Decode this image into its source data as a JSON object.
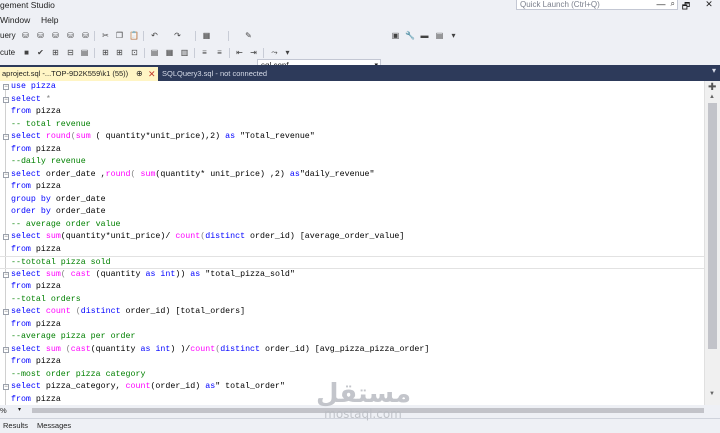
{
  "window": {
    "title": "gement Studio",
    "quick_launch_placeholder": "Quick Launch (Ctrl+Q)",
    "controls": [
      "—",
      "🗗",
      "✕"
    ]
  },
  "menu": [
    "Window",
    "Help"
  ],
  "toolbar1": {
    "left_label": "uery",
    "database": "sql conf"
  },
  "toolbar2": {
    "left_label": "cute"
  },
  "tabs": [
    {
      "label": "aproject.sql -...TOP-9D2K559\\k1 (55))",
      "pin": "⊕",
      "close": "✕",
      "active": true
    },
    {
      "label": "SQLQuery3.sql - not connected",
      "active": false
    }
  ],
  "editor": {
    "lines": [
      {
        "fold": "−",
        "segments": [
          {
            "t": "use pizza",
            "c": "kw"
          }
        ]
      },
      {
        "fold": "−",
        "segments": [
          {
            "t": "select",
            "c": "kw"
          },
          {
            "t": " *",
            "c": "gr"
          }
        ]
      },
      {
        "fold": "",
        "segments": [
          {
            "t": "from",
            "c": "kw"
          },
          {
            "t": " pizza",
            "c": "tx"
          }
        ]
      },
      {
        "fold": "",
        "segments": [
          {
            "t": "-- total revenue",
            "c": "cm"
          }
        ]
      },
      {
        "fold": "−",
        "segments": [
          {
            "t": "select",
            "c": "kw"
          },
          {
            "t": " ",
            "c": "tx"
          },
          {
            "t": "round",
            "c": "fn"
          },
          {
            "t": "(",
            "c": "gr"
          },
          {
            "t": "sum",
            "c": "fn"
          },
          {
            "t": " ( quantity*unit_price),2) ",
            "c": "tx"
          },
          {
            "t": "as",
            "c": "kw"
          },
          {
            "t": " \"Total_revenue\"",
            "c": "tx"
          }
        ]
      },
      {
        "fold": "",
        "segments": [
          {
            "t": "from",
            "c": "kw"
          },
          {
            "t": " pizza",
            "c": "tx"
          }
        ]
      },
      {
        "fold": "",
        "segments": [
          {
            "t": "--daily revenue",
            "c": "cm"
          }
        ]
      },
      {
        "fold": "−",
        "segments": [
          {
            "t": "select",
            "c": "kw"
          },
          {
            "t": " order_date ,",
            "c": "tx"
          },
          {
            "t": "round",
            "c": "fn"
          },
          {
            "t": "( ",
            "c": "gr"
          },
          {
            "t": "sum",
            "c": "fn"
          },
          {
            "t": "(quantity* unit_price) ,2) ",
            "c": "tx"
          },
          {
            "t": "as",
            "c": "kw"
          },
          {
            "t": "\"daily_revenue\"",
            "c": "tx"
          }
        ]
      },
      {
        "fold": "",
        "segments": [
          {
            "t": "from",
            "c": "kw"
          },
          {
            "t": " pizza",
            "c": "tx"
          }
        ]
      },
      {
        "fold": "",
        "segments": [
          {
            "t": "group by",
            "c": "kw"
          },
          {
            "t": " order_date",
            "c": "tx"
          }
        ]
      },
      {
        "fold": "",
        "segments": [
          {
            "t": "order by",
            "c": "kw"
          },
          {
            "t": " order_date",
            "c": "tx"
          }
        ]
      },
      {
        "fold": "",
        "segments": [
          {
            "t": "-- average order value",
            "c": "cm"
          }
        ]
      },
      {
        "fold": "−",
        "segments": [
          {
            "t": "select",
            "c": "kw"
          },
          {
            "t": " ",
            "c": "tx"
          },
          {
            "t": "sum",
            "c": "fn"
          },
          {
            "t": "(quantity*unit_price)/ ",
            "c": "tx"
          },
          {
            "t": "count",
            "c": "fn"
          },
          {
            "t": "(",
            "c": "gr"
          },
          {
            "t": "distinct",
            "c": "kw"
          },
          {
            "t": " order_id) [average_order_value]",
            "c": "tx"
          }
        ]
      },
      {
        "fold": "",
        "segments": [
          {
            "t": "from",
            "c": "kw"
          },
          {
            "t": " pizza",
            "c": "tx"
          }
        ]
      },
      {
        "fold": "",
        "cursor": true,
        "segments": [
          {
            "t": "--tototal pizza sold",
            "c": "cm"
          }
        ]
      },
      {
        "fold": "−",
        "segments": [
          {
            "t": "select",
            "c": "kw"
          },
          {
            "t": " ",
            "c": "tx"
          },
          {
            "t": "sum",
            "c": "fn"
          },
          {
            "t": "( ",
            "c": "gr"
          },
          {
            "t": "cast",
            "c": "fn"
          },
          {
            "t": " (quantity ",
            "c": "tx"
          },
          {
            "t": "as",
            "c": "kw"
          },
          {
            "t": " ",
            "c": "tx"
          },
          {
            "t": "int",
            "c": "kw"
          },
          {
            "t": ")) ",
            "c": "tx"
          },
          {
            "t": "as",
            "c": "kw"
          },
          {
            "t": " \"total_pizza_sold\"",
            "c": "tx"
          }
        ]
      },
      {
        "fold": "",
        "segments": [
          {
            "t": "from",
            "c": "kw"
          },
          {
            "t": " pizza",
            "c": "tx"
          }
        ]
      },
      {
        "fold": "",
        "segments": [
          {
            "t": "--total orders",
            "c": "cm"
          }
        ]
      },
      {
        "fold": "−",
        "segments": [
          {
            "t": "select",
            "c": "kw"
          },
          {
            "t": " ",
            "c": "tx"
          },
          {
            "t": "count",
            "c": "fn"
          },
          {
            "t": " (",
            "c": "gr"
          },
          {
            "t": "distinct",
            "c": "kw"
          },
          {
            "t": " order_id) [total_orders]",
            "c": "tx"
          }
        ]
      },
      {
        "fold": "",
        "segments": [
          {
            "t": "from",
            "c": "kw"
          },
          {
            "t": " pizza",
            "c": "tx"
          }
        ]
      },
      {
        "fold": "",
        "segments": [
          {
            "t": "--average pizza per order",
            "c": "cm"
          }
        ]
      },
      {
        "fold": "−",
        "segments": [
          {
            "t": "select",
            "c": "kw"
          },
          {
            "t": " ",
            "c": "tx"
          },
          {
            "t": "sum",
            "c": "fn"
          },
          {
            "t": " (",
            "c": "gr"
          },
          {
            "t": "cast",
            "c": "fn"
          },
          {
            "t": "(quantity ",
            "c": "tx"
          },
          {
            "t": "as",
            "c": "kw"
          },
          {
            "t": " ",
            "c": "tx"
          },
          {
            "t": "int",
            "c": "kw"
          },
          {
            "t": ") )/",
            "c": "tx"
          },
          {
            "t": "count",
            "c": "fn"
          },
          {
            "t": "(",
            "c": "gr"
          },
          {
            "t": "distinct",
            "c": "kw"
          },
          {
            "t": " order_id) [avg_pizza_pizza_order]",
            "c": "tx"
          }
        ]
      },
      {
        "fold": "",
        "segments": [
          {
            "t": "from",
            "c": "kw"
          },
          {
            "t": " pizza",
            "c": "tx"
          }
        ]
      },
      {
        "fold": "",
        "segments": [
          {
            "t": "--most order pizza category",
            "c": "cm"
          }
        ]
      },
      {
        "fold": "−",
        "segments": [
          {
            "t": "select",
            "c": "kw"
          },
          {
            "t": " pizza_category, ",
            "c": "tx"
          },
          {
            "t": "count",
            "c": "fn"
          },
          {
            "t": "(order_id) ",
            "c": "tx"
          },
          {
            "t": "as",
            "c": "kw"
          },
          {
            "t": "\" total_order\"",
            "c": "tx"
          }
        ]
      },
      {
        "fold": "",
        "segments": [
          {
            "t": "from",
            "c": "kw"
          },
          {
            "t": " pizza",
            "c": "tx"
          }
        ]
      }
    ],
    "syntax_colors": {
      "kw": "#0000ff",
      "fn": "#ff00ff",
      "str": "#a31515",
      "cm": "#008000",
      "gr": "#808080",
      "tx": "#000000"
    }
  },
  "zoom": {
    "value": "%"
  },
  "result_tabs": [
    "Results",
    "Messages"
  ],
  "watermark": {
    "logo": "مستقل",
    "text": "mostaql.com"
  }
}
